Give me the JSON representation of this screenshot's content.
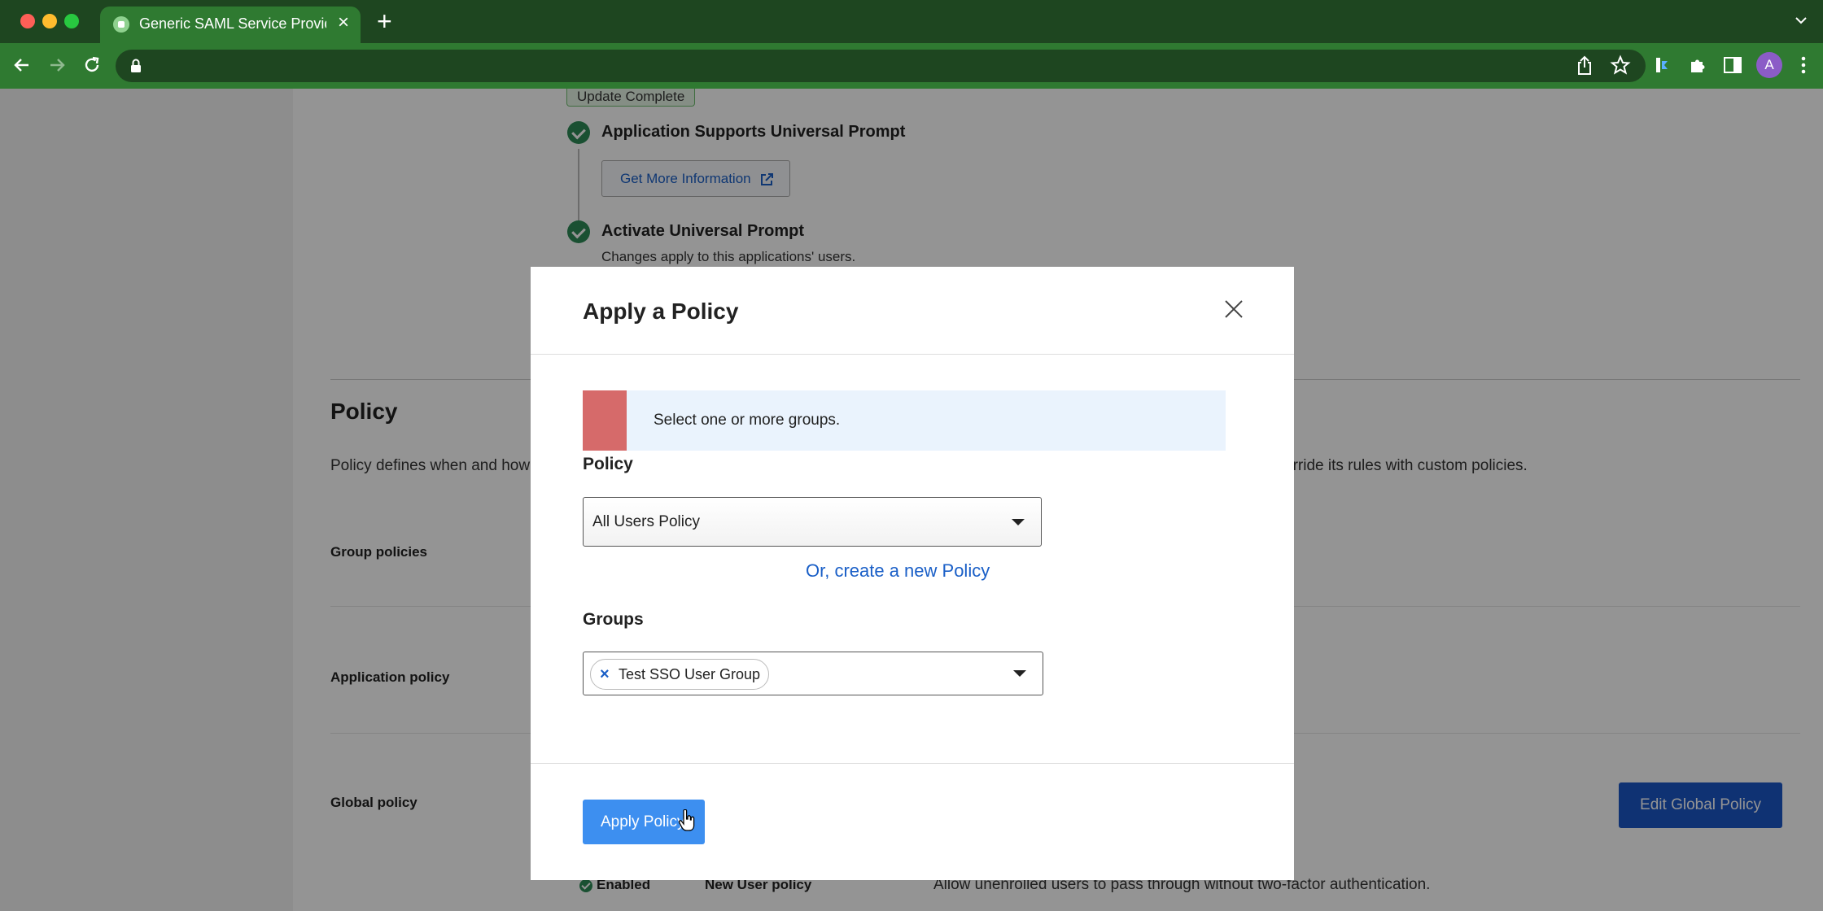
{
  "browser": {
    "tab_title": "Generic SAML Service Provider",
    "avatar_initial": "A"
  },
  "background": {
    "update_badge": "Update Complete",
    "step1_title": "Application Supports Universal Prompt",
    "info_button": "Get More Information",
    "step2_title": "Activate Universal Prompt",
    "step2_subtitle": "Changes apply to this applications' users.",
    "policy_heading": "Policy",
    "policy_desc_left": "Policy defines when and how",
    "policy_desc_right": "erride its rules with custom policies.",
    "group_policies_label": "Group policies",
    "application_policy_label": "Application policy",
    "global_policy_label": "Global policy",
    "edit_global_button": "Edit Global Policy",
    "enabled_label": "Enabled",
    "new_user_policy_label": "New User policy",
    "new_user_policy_desc": "Allow unenrolled users to pass through without two-factor authentication."
  },
  "modal": {
    "title": "Apply a Policy",
    "alert_text": "Select one or more groups.",
    "policy_label": "Policy",
    "policy_selected": "All Users Policy",
    "create_link": "Or, create a new Policy",
    "groups_label": "Groups",
    "group_chip": "Test SSO User Group",
    "apply_button": "Apply Policy"
  },
  "colors": {
    "browser_frame": "#1e4620",
    "browser_toolbar": "#2f7a31",
    "primary_blue": "#1a56c7",
    "apply_blue": "#3d8ff0",
    "alert_red": "#d66a6a",
    "alert_bg": "#eaf3fd",
    "success_green": "#2e8b57"
  }
}
